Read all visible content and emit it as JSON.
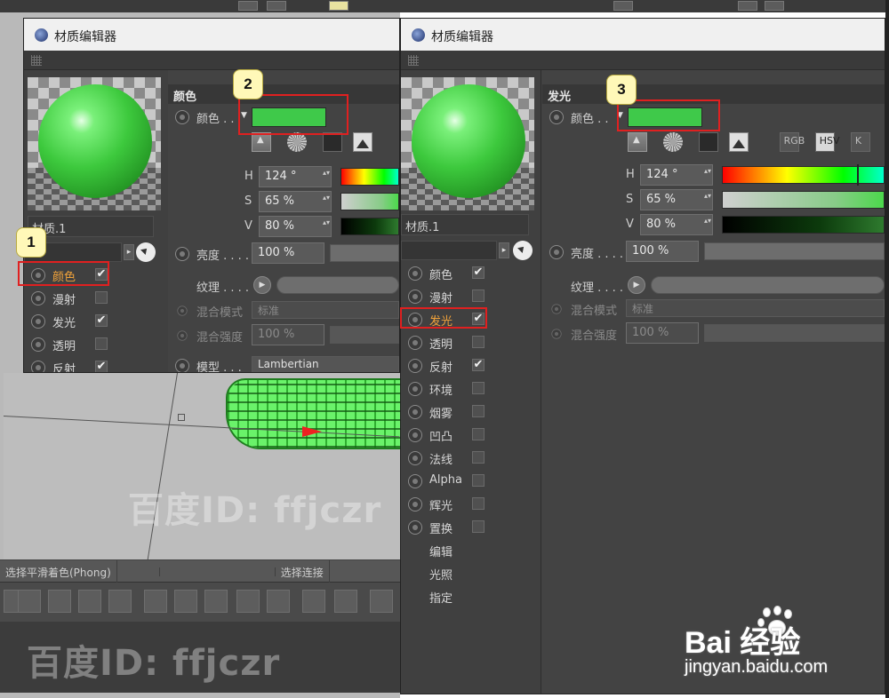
{
  "left_window": {
    "title": "材质编辑器",
    "material_name": "材质.1",
    "section_header": "颜色",
    "color_label": "颜色 . .",
    "color_swatch": "#3fc94a",
    "hsv": [
      {
        "label": "H",
        "value": "124 °"
      },
      {
        "label": "S",
        "value": "65 %"
      },
      {
        "label": "V",
        "value": "80 %"
      }
    ],
    "brightness_label": "亮度 . . . .",
    "brightness_value": "100 %",
    "texture_label": "纹理 . . . .",
    "mix_mode_label": "混合模式",
    "mix_mode_value": "标准",
    "mix_strength_label": "混合强度",
    "mix_strength_value": "100 %",
    "model_label": "模型 . . .",
    "model_value": "Lambertian",
    "channels": [
      {
        "label": "颜色",
        "checked": true,
        "active": true
      },
      {
        "label": "漫射",
        "checked": false
      },
      {
        "label": "发光",
        "checked": true
      },
      {
        "label": "透明",
        "checked": false
      },
      {
        "label": "反射",
        "checked": true
      }
    ]
  },
  "right_window": {
    "title": "材质编辑器",
    "material_name": "材质.1",
    "section_header": "发光",
    "color_label": "颜色 . .",
    "color_swatch": "#3fc94a",
    "mode_buttons": [
      "RGB",
      "HSV",
      "K"
    ],
    "active_mode": "HSV",
    "hsv": [
      {
        "label": "H",
        "value": "124 °"
      },
      {
        "label": "S",
        "value": "65 %"
      },
      {
        "label": "V",
        "value": "80 %"
      }
    ],
    "brightness_label": "亮度 . . . .",
    "brightness_value": "100 %",
    "texture_label": "纹理 . . . .",
    "mix_mode_label": "混合模式",
    "mix_mode_value": "标准",
    "mix_strength_label": "混合强度",
    "mix_strength_value": "100 %",
    "channels": [
      {
        "label": "颜色",
        "checked": true
      },
      {
        "label": "漫射",
        "checked": false
      },
      {
        "label": "发光",
        "checked": true,
        "active": true
      },
      {
        "label": "透明",
        "checked": false
      },
      {
        "label": "反射",
        "checked": true
      },
      {
        "label": "环境",
        "checked": false
      },
      {
        "label": "烟雾",
        "checked": false
      },
      {
        "label": "凹凸",
        "checked": false
      },
      {
        "label": "法线",
        "checked": false
      },
      {
        "label": "Alpha",
        "checked": false
      },
      {
        "label": "辉光",
        "checked": false
      },
      {
        "label": "置换",
        "checked": false
      },
      {
        "label": "编辑",
        "nocheck": true
      },
      {
        "label": "光照",
        "nocheck": true
      },
      {
        "label": "指定",
        "nocheck": true
      }
    ]
  },
  "background": {
    "modebar_items": [
      "选择平滑着色(Phong)",
      "",
      "",
      "选择连接"
    ],
    "watermark_text": "百度ID: ffjczr"
  },
  "annotations": [
    "1",
    "2",
    "3"
  ],
  "baidu": {
    "brand": "Bai  经验",
    "site": "jingyan.baidu.com"
  }
}
